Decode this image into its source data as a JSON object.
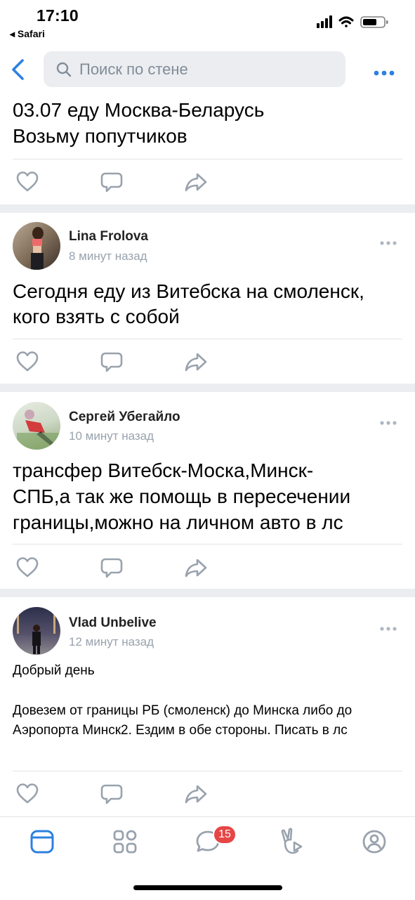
{
  "status_bar": {
    "time": "17:10",
    "back_app": "◂ Safari"
  },
  "header": {
    "search_placeholder": "Поиск по стене"
  },
  "posts": [
    {
      "text_lines": [
        "03.07 еду Москва-Беларусь",
        "Возьму попутчиков"
      ]
    },
    {
      "author": "Lina Frolova",
      "time": "8 минут назад",
      "text_lines": [
        "Сегодня еду из Витебска на смоленск,",
        "кого взять с собой"
      ]
    },
    {
      "author": "Сергей Убегайло",
      "time": "10 минут назад",
      "text_lines": [
        "трансфер Витебск-Моска,Минск-",
        "СПБ,а так же помощь в пересечении",
        "границы,можно на личном авто в лс"
      ]
    },
    {
      "author": "Vlad Unbelive",
      "time": "12 минут назад",
      "greeting": "Добрый день",
      "body": "Довезем от границы РБ (смоленск) до Минска либо до Аэропорта Минск2. Ездим в обе стороны. Писать в лс"
    }
  ],
  "tabbar": {
    "messages_badge": "15",
    "active_tab": "news"
  },
  "colors": {
    "accent": "#2d81e0",
    "icon_gray": "#99a2ad",
    "separator": "#ebedf0",
    "badge": "#e64646"
  }
}
